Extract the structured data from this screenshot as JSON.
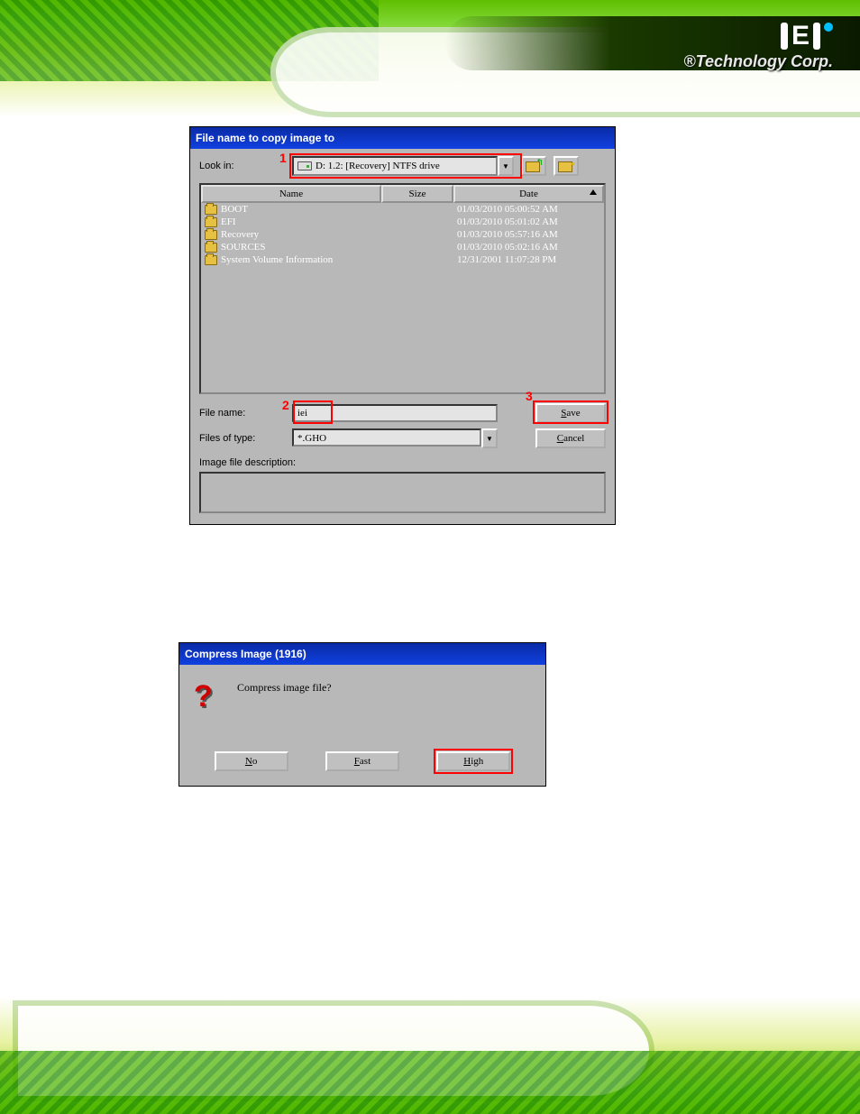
{
  "company": {
    "registered": "®",
    "name": "Technology Corp."
  },
  "dialog1": {
    "title": "File name to copy image to",
    "lookin_label": "Look in:",
    "lookin_value": "D: 1.2: [Recovery] NTFS drive",
    "marker1": "1",
    "columns": {
      "name": "Name",
      "size": "Size",
      "date": "Date"
    },
    "rows": [
      {
        "name": "BOOT",
        "size": "",
        "date": "01/03/2010 05:00:52 AM"
      },
      {
        "name": "EFI",
        "size": "",
        "date": "01/03/2010 05:01:02 AM"
      },
      {
        "name": "Recovery",
        "size": "",
        "date": "01/03/2010 05:57:16 AM"
      },
      {
        "name": "SOURCES",
        "size": "",
        "date": "01/03/2010 05:02:16 AM"
      },
      {
        "name": "System Volume Information",
        "size": "",
        "date": "12/31/2001 11:07:28 PM"
      }
    ],
    "filename_label": "File name:",
    "filename_value": "iei",
    "marker2": "2",
    "filter_label": "Files of type:",
    "filter_value": "*.GHO",
    "desc_label": "Image file description:",
    "save_label": "Save",
    "marker3": "3",
    "cancel_label": "Cancel"
  },
  "dialog2": {
    "title": "Compress Image (1916)",
    "question": "Compress image file?",
    "no_label": "No",
    "fast_label": "Fast",
    "high_label": "High"
  }
}
